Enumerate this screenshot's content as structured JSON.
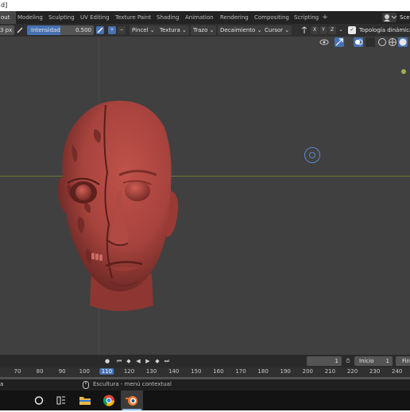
{
  "window": {
    "title_fragment": "d]"
  },
  "workspace_tabs": [
    {
      "label": "out",
      "active": true
    },
    {
      "label": "Modeling",
      "active": false
    },
    {
      "label": "Sculpting",
      "active": false
    },
    {
      "label": "UV Editing",
      "active": false
    },
    {
      "label": "Texture Paint",
      "active": false
    },
    {
      "label": "Shading",
      "active": false
    },
    {
      "label": "Animation",
      "active": false
    },
    {
      "label": "Rendering",
      "active": false
    },
    {
      "label": "Compositing",
      "active": false
    },
    {
      "label": "Scripting",
      "active": false
    }
  ],
  "scene_label": "Scen",
  "tool_header": {
    "radius_value": "3 px",
    "strength_label": "Intensidad",
    "strength_value": "0.500",
    "plus_symbol": "+",
    "minus_symbol": "−",
    "brush_menu": "Pincel",
    "texture_menu": "Textura",
    "stroke_menu": "Trazo",
    "falloff_menu": "Decaimiento",
    "cursor_menu": "Cursor",
    "axis_x": "X",
    "axis_y": "Y",
    "axis_z": "Z",
    "dyntopo_label": "Topología dinámica",
    "dyntopo_checked": true
  },
  "timeline": {
    "current_frame": "1",
    "start_label": "Inicio",
    "start_value": "1",
    "end_label": "Fin",
    "ruler_ticks": [
      "70",
      "80",
      "90",
      "100",
      "110",
      "120",
      "130",
      "140",
      "150",
      "160",
      "170",
      "180",
      "190",
      "200",
      "210",
      "220",
      "230",
      "240"
    ],
    "current_tick": "110"
  },
  "status_bar": {
    "left_fragment": "a",
    "message": "Escultura - menú contextual"
  },
  "colors": {
    "viewport_bg": "#404040",
    "active_accent": "#4772b3",
    "sculpt_skin": "#a7433d",
    "horizon_line": "#7d8a2e"
  },
  "icons": {
    "cortana": "ring-icon",
    "taskview": "task-view-icon",
    "explorer": "folder-icon",
    "chrome": "chrome-icon",
    "blender": "blender-icon"
  }
}
